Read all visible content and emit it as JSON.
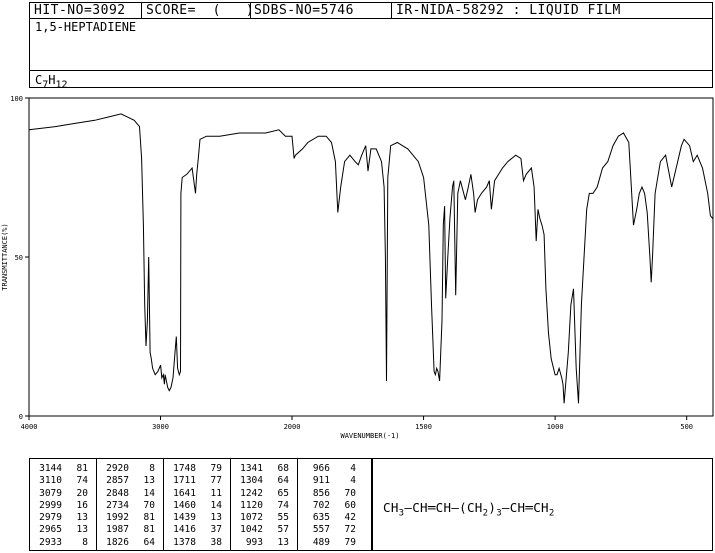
{
  "header": {
    "hit_no": "HIT-NO=3092",
    "score": "SCORE=  (   )",
    "sdbs_no": "SDBS-NO=5746",
    "ir_info": "IR-NIDA-58292 : LIQUID FILM"
  },
  "compound_name": "1,5-HEPTADIENE",
  "formula": {
    "c": "C",
    "c_sub": "7",
    "h": "H",
    "h_sub": "12"
  },
  "structure": {
    "parts": [
      "CH",
      "3",
      "—CH═CH—(CH",
      "2",
      ")",
      "3",
      "—CH═CH",
      "2"
    ]
  },
  "chart_data": {
    "type": "line",
    "xlabel": "WAVENUMBER(-1)",
    "ylabel": "TRANSMITTANCE(%)",
    "xlim": [
      4000,
      400
    ],
    "ylim": [
      0,
      100
    ],
    "x_ticks": [
      4000,
      3000,
      2000,
      1500,
      1000,
      500
    ],
    "y_ticks": [
      0,
      50,
      100
    ],
    "x_tick_labels": [
      "4000",
      "3000",
      "2000",
      "1500",
      "1000",
      "500"
    ],
    "y_tick_labels": [
      "0",
      "50",
      "100"
    ],
    "x": [
      4000,
      3800,
      3650,
      3500,
      3400,
      3300,
      3250,
      3200,
      3180,
      3160,
      3144,
      3130,
      3120,
      3110,
      3100,
      3090,
      3079,
      3070,
      3060,
      3040,
      3020,
      2999,
      2990,
      2979,
      2970,
      2965,
      2955,
      2945,
      2933,
      2920,
      2905,
      2890,
      2880,
      2870,
      2857,
      2848,
      2845,
      2835,
      2800,
      2760,
      2734,
      2725,
      2715,
      2700,
      2650,
      2550,
      2400,
      2300,
      2200,
      2100,
      2050,
      2000,
      1992,
      1987,
      1960,
      1940,
      1900,
      1870,
      1850,
      1835,
      1826,
      1815,
      1800,
      1780,
      1760,
      1748,
      1735,
      1720,
      1711,
      1700,
      1680,
      1660,
      1650,
      1645,
      1641,
      1636,
      1625,
      1600,
      1580,
      1560,
      1540,
      1520,
      1500,
      1480,
      1470,
      1460,
      1455,
      1450,
      1445,
      1439,
      1430,
      1425,
      1420,
      1416,
      1408,
      1400,
      1390,
      1385,
      1378,
      1370,
      1360,
      1341,
      1330,
      1320,
      1310,
      1304,
      1295,
      1280,
      1260,
      1250,
      1242,
      1230,
      1200,
      1180,
      1150,
      1130,
      1120,
      1110,
      1090,
      1080,
      1072,
      1065,
      1058,
      1050,
      1042,
      1035,
      1025,
      1015,
      1000,
      993,
      985,
      975,
      970,
      966,
      958,
      950,
      940,
      930,
      920,
      911,
      900,
      880,
      870,
      856,
      840,
      820,
      800,
      780,
      760,
      740,
      720,
      702,
      690,
      680,
      670,
      660,
      650,
      640,
      635,
      630,
      620,
      600,
      580,
      557,
      540,
      520,
      510,
      489,
      475,
      460,
      440,
      420,
      410,
      400
    ],
    "y": [
      90,
      91,
      92,
      93,
      94,
      95,
      94,
      93,
      92,
      91,
      81,
      60,
      35,
      22,
      30,
      50,
      20,
      18,
      15,
      13,
      14,
      16,
      12,
      13,
      10,
      13,
      11,
      9,
      8,
      9,
      12,
      20,
      25,
      15,
      13,
      14,
      70,
      75,
      76,
      78,
      70,
      76,
      80,
      87,
      88,
      88,
      89,
      89,
      89,
      90,
      88,
      88,
      81,
      82,
      84,
      86,
      88,
      88,
      86,
      80,
      64,
      72,
      80,
      82,
      80,
      79,
      82,
      85,
      77,
      84,
      84,
      80,
      72,
      50,
      11,
      75,
      85,
      86,
      85,
      84,
      82,
      80,
      75,
      60,
      35,
      14,
      13,
      15,
      14,
      11,
      30,
      60,
      66,
      37,
      50,
      62,
      72,
      74,
      38,
      70,
      74,
      68,
      72,
      76,
      70,
      64,
      68,
      70,
      72,
      74,
      65,
      74,
      78,
      80,
      82,
      81,
      74,
      76,
      78,
      72,
      55,
      65,
      62,
      60,
      57,
      40,
      26,
      18,
      13,
      13,
      15,
      12,
      10,
      4,
      12,
      20,
      35,
      40,
      15,
      4,
      35,
      65,
      70,
      70,
      72,
      78,
      80,
      85,
      88,
      89,
      86,
      60,
      65,
      70,
      72,
      70,
      64,
      50,
      42,
      50,
      70,
      80,
      82,
      72,
      78,
      85,
      87,
      85,
      80,
      82,
      78,
      70,
      63,
      62
    ]
  },
  "peak_table": {
    "columns": [
      [
        [
          "3144",
          "81"
        ],
        [
          "3110",
          "74"
        ],
        [
          "3079",
          "20"
        ],
        [
          "2999",
          "16"
        ],
        [
          "2979",
          "13"
        ],
        [
          "2965",
          "13"
        ],
        [
          "2933",
          "8"
        ]
      ],
      [
        [
          "2920",
          "8"
        ],
        [
          "2857",
          "13"
        ],
        [
          "2848",
          "14"
        ],
        [
          "2734",
          "70"
        ],
        [
          "1992",
          "81"
        ],
        [
          "1987",
          "81"
        ],
        [
          "1826",
          "64"
        ]
      ],
      [
        [
          "1748",
          "79"
        ],
        [
          "1711",
          "77"
        ],
        [
          "1641",
          "11"
        ],
        [
          "1460",
          "14"
        ],
        [
          "1439",
          "13"
        ],
        [
          "1416",
          "37"
        ],
        [
          "1378",
          "38"
        ]
      ],
      [
        [
          "1341",
          "68"
        ],
        [
          "1304",
          "64"
        ],
        [
          "1242",
          "65"
        ],
        [
          "1120",
          "74"
        ],
        [
          "1072",
          "55"
        ],
        [
          "1042",
          "57"
        ],
        [
          "993",
          "13"
        ]
      ],
      [
        [
          "966",
          "4"
        ],
        [
          "911",
          "4"
        ],
        [
          "856",
          "70"
        ],
        [
          "702",
          "60"
        ],
        [
          "635",
          "42"
        ],
        [
          "557",
          "72"
        ],
        [
          "489",
          "79"
        ]
      ]
    ]
  }
}
